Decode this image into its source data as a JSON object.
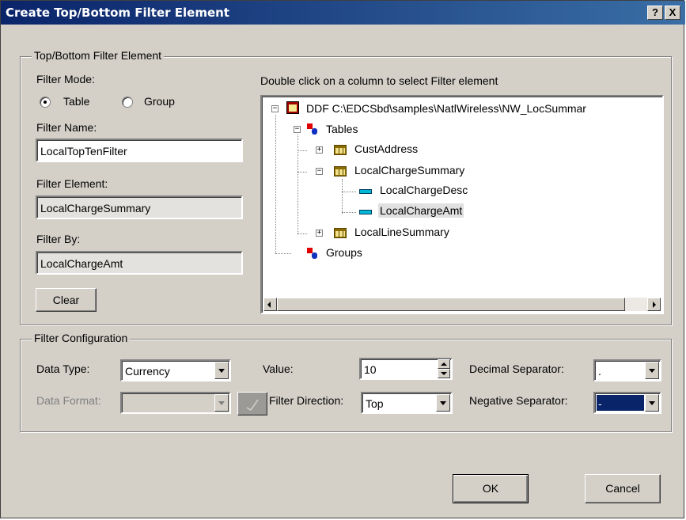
{
  "window": {
    "title": "Create Top/Bottom Filter Element",
    "help_label": "?",
    "close_label": "X"
  },
  "top_group": {
    "legend": "Top/Bottom Filter Element",
    "filter_mode_label": "Filter Mode:",
    "mode_options": [
      "Table",
      "Group"
    ],
    "mode_selected": "Table",
    "filter_name_label": "Filter Name:",
    "filter_name_value": "LocalTopTenFilter",
    "filter_element_label": "Filter Element:",
    "filter_element_value": "LocalChargeSummary",
    "filter_by_label": "Filter By:",
    "filter_by_value": "LocalChargeAmt",
    "clear_label": "Clear",
    "tree_instruction": "Double click on a column to select Filter element"
  },
  "tree": {
    "root": "DDF C:\\EDCSbd\\samples\\NatlWireless\\NW_LocSummar",
    "tables_label": "Tables",
    "tables": [
      {
        "name": "CustAddress",
        "expanded": false
      },
      {
        "name": "LocalChargeSummary",
        "expanded": true,
        "columns": [
          "LocalChargeDesc",
          "LocalChargeAmt"
        ]
      },
      {
        "name": "LocalLineSummary",
        "expanded": false
      }
    ],
    "groups_label": "Groups",
    "selected": "LocalChargeAmt"
  },
  "config_group": {
    "legend": "Filter Configuration",
    "data_type_label": "Data Type:",
    "data_type_value": "Currency",
    "data_format_label": "Data Format:",
    "data_format_value": "",
    "value_label": "Value:",
    "value_value": "10",
    "filter_direction_label": "Filter Direction:",
    "filter_direction_value": "Top",
    "decimal_separator_label": "Decimal Separator:",
    "decimal_separator_value": ".",
    "negative_separator_label": "Negative Separator:",
    "negative_separator_value": "-"
  },
  "footer": {
    "ok_label": "OK",
    "cancel_label": "Cancel"
  },
  "colors": {
    "title_start": "#0a246a",
    "title_end": "#3a6ea5",
    "face": "#d4d0c8",
    "selection": "#0a246a"
  }
}
